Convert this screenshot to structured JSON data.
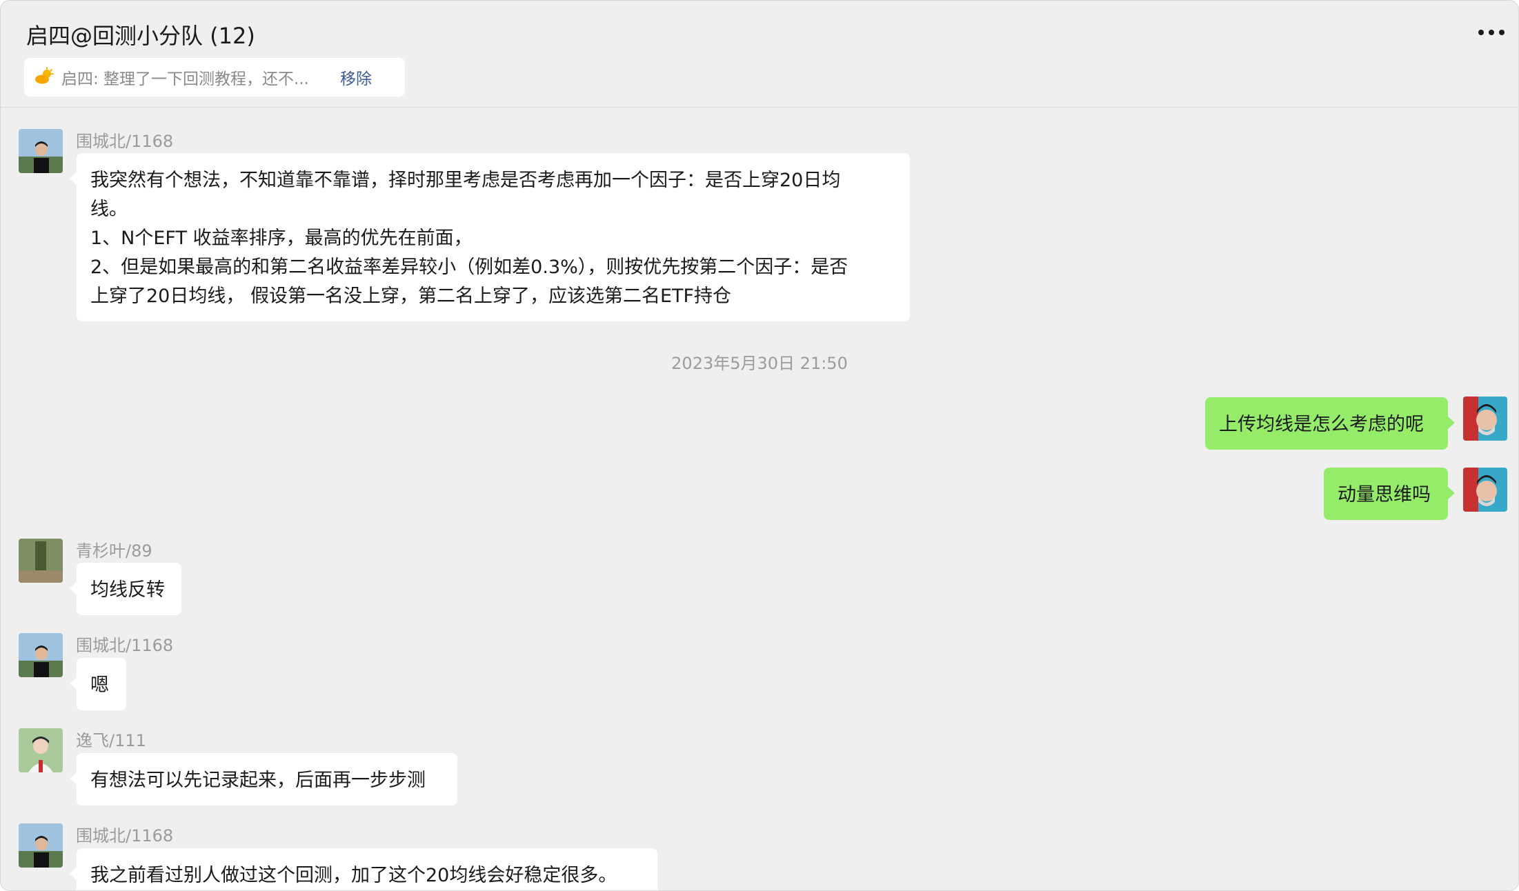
{
  "header": {
    "title": "启四@回测小分队 (12)",
    "more_icon": "more-horizontal-icon"
  },
  "pinned": {
    "icon": "sun-cloud-icon",
    "text": "启四: 整理了一下回测教程，还不...",
    "remove_label": "移除"
  },
  "messages": [
    {
      "sender": "围城北/1168",
      "text": "我突然有个想法，不知道靠不靠谱，择时那里考虑是否考虑再加一个因子：是否上穿20日均\n线。\n1、N个EFT 收益率排序，最高的优先在前面，\n2、但是如果最高的和第二名收益率差异较小（例如差0.3%），则按优先按第二个因子：是否\n上穿了20日均线， 假设第一名没上穿，第二名上穿了，应该选第二名ETF持仓"
    },
    {
      "timestamp": "2023年5月30日 21:50"
    },
    {
      "text": "上传均线是怎么考虑的呢"
    },
    {
      "text": "动量思维吗"
    },
    {
      "sender": "青杉叶/89",
      "text": "均线反转"
    },
    {
      "sender": "围城北/1168",
      "text": "嗯"
    },
    {
      "sender": "逸飞/111",
      "text": "有想法可以先记录起来，后面再一步步测"
    },
    {
      "sender": "围城北/1168",
      "text": "我之前看过别人做过这个回测，加了这个20均线会好稳定很多。"
    }
  ],
  "colors": {
    "background": "#efefef",
    "bubble_other": "#ffffff",
    "bubble_mine": "#95ec69",
    "pinned_remove": "#3b5b97"
  }
}
